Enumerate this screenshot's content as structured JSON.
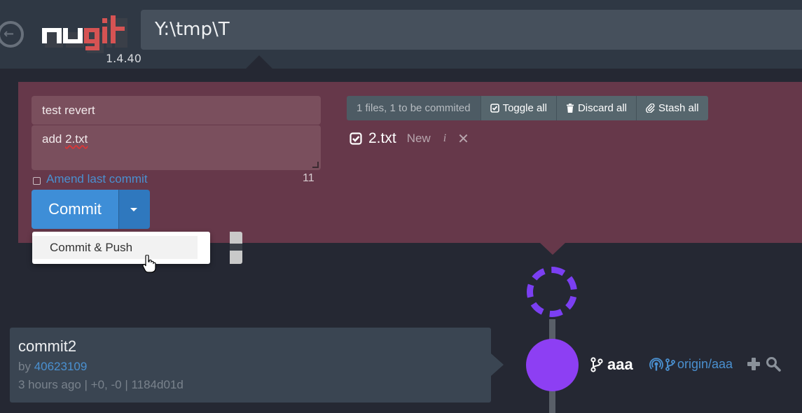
{
  "header": {
    "version": "1.4.40",
    "path": "Y:\\tmp\\T",
    "logo_text": "ungit"
  },
  "staging": {
    "commit_title": "test revert",
    "commit_body_prefix": "add ",
    "commit_body_filename": "2.txt",
    "amend_label": "Amend last commit",
    "char_count": "11",
    "commit_button": "Commit",
    "dropdown_item": "Commit & Push",
    "files_count": "1 files, 1 to be commited",
    "toggle_all": "Toggle all",
    "discard_all": "Discard all",
    "stash_all": "Stash all",
    "files": [
      {
        "name": "2.txt",
        "status": "New",
        "info": "i",
        "discard": "✕"
      }
    ]
  },
  "graph": {
    "branch": "aaa",
    "remote_branch": "origin/aaa",
    "node_color": "#8d3ff3",
    "pending_color": "#7b3ff2"
  },
  "commit": {
    "title": "commit2",
    "author_prefix": "by ",
    "author": "40623109",
    "meta": "3 hours ago | +0, -0 | 1184d01d"
  },
  "colors": {
    "background": "#252833",
    "header": "#2f3844",
    "staging": "#66384a",
    "accent": "#3e8ed7",
    "link": "#4a90d0"
  }
}
